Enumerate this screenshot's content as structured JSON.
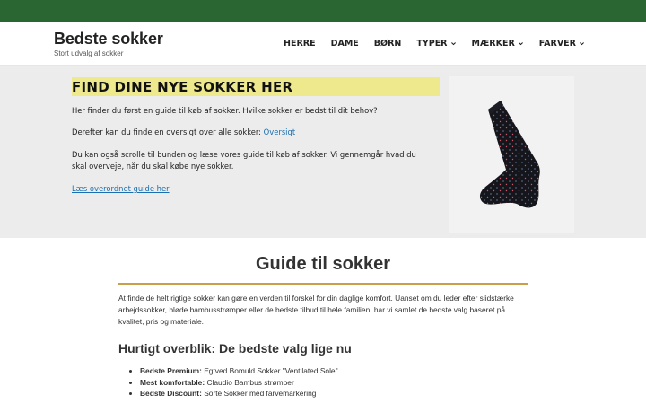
{
  "site": {
    "title": "Bedste sokker",
    "tagline": "Stort udvalg af sokker"
  },
  "nav": {
    "items": [
      {
        "label": "HERRE",
        "has_dropdown": false
      },
      {
        "label": "DAME",
        "has_dropdown": false
      },
      {
        "label": "BØRN",
        "has_dropdown": false
      },
      {
        "label": "TYPER",
        "has_dropdown": true
      },
      {
        "label": "MÆRKER",
        "has_dropdown": true
      },
      {
        "label": "FARVER",
        "has_dropdown": true
      }
    ]
  },
  "hero": {
    "heading": "FIND DINE NYE SOKKER HER",
    "p1": "Her finder du først en guide til køb af sokker. Hvilke sokker er bedst til dit behov?",
    "p2_text": "Derefter kan du finde en oversigt over alle sokker: ",
    "p2_link": "Oversigt",
    "p3": "Du kan også scrolle til bunden og læse vores guide til køb af sokker. Vi gennemgår hvad du skal overveje, når du skal købe nye sokker.",
    "guide_link": "Læs overordnet guide her",
    "image_icon": "sock-image"
  },
  "guide": {
    "title": "Guide til sokker",
    "intro": "At finde de helt rigtige sokker kan gøre en verden til forskel for din daglige komfort. Uanset om du leder efter slidstærke arbejdssokker, bløde bambusstrømper eller de bedste tilbud til hele familien, har vi samlet de bedste valg baseret på kvalitet, pris og materiale.",
    "overview_title": "Hurtigt overblik: De bedste valg lige nu",
    "best": [
      {
        "label": "Bedste Premium:",
        "value": " Egtved Bomuld Sokker \"Ventilated Sole\""
      },
      {
        "label": "Mest komfortable:",
        "value": " Claudio Bambus strømper"
      },
      {
        "label": "Bedste Discount:",
        "value": " Sorte Sokker med farvemarkering"
      }
    ]
  },
  "colors": {
    "topbar": "#2a6632",
    "heading_highlight": "#efe98e",
    "rule": "#c9a04a",
    "link": "#1a6fb0"
  }
}
